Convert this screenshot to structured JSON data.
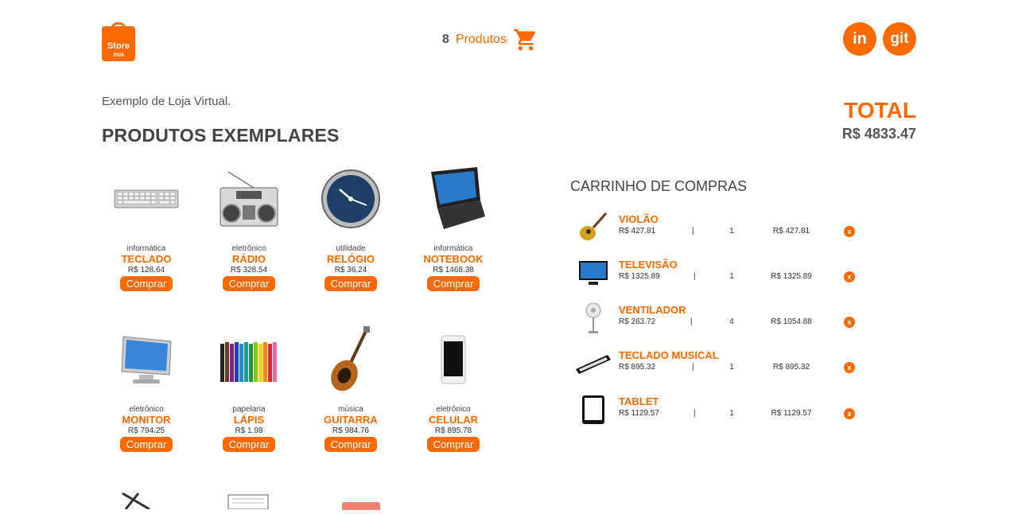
{
  "header": {
    "logo_text": "Store",
    "logo_year": "2024",
    "cart_count": "8",
    "cart_label": "Produtos",
    "social_linkedin": "in",
    "social_git": "git"
  },
  "intro": {
    "subtitle": "Exemplo de Loja Virtual.",
    "section_title": "PRODUTOS EXEMPLARES"
  },
  "total": {
    "label": "TOTAL",
    "value": "R$ 4833.47"
  },
  "products": [
    {
      "category": "informática",
      "name": "TECLADO",
      "price": "R$ 128.64",
      "button": "Comprar",
      "icon": "keyboard-icon"
    },
    {
      "category": "eletrônico",
      "name": "RÁDIO",
      "price": "R$ 328.54",
      "button": "Comprar",
      "icon": "radio-icon"
    },
    {
      "category": "utilidade",
      "name": "RELÓGIO",
      "price": "R$ 36.24",
      "button": "Comprar",
      "icon": "clock-icon"
    },
    {
      "category": "informática",
      "name": "NOTEBOOK",
      "price": "R$ 1468.38",
      "button": "Comprar",
      "icon": "laptop-icon"
    },
    {
      "category": "eletrônico",
      "name": "MONITOR",
      "price": "R$ 794.25",
      "button": "Comprar",
      "icon": "monitor-icon"
    },
    {
      "category": "papelaria",
      "name": "LÁPIS",
      "price": "R$ 1.98",
      "button": "Comprar",
      "icon": "pencils-icon"
    },
    {
      "category": "música",
      "name": "GUITARRA",
      "price": "R$ 984.76",
      "button": "Comprar",
      "icon": "guitar-icon"
    },
    {
      "category": "eletrônico",
      "name": "CELULAR",
      "price": "R$ 895.78",
      "button": "Comprar",
      "icon": "phone-icon"
    }
  ],
  "cart": {
    "title": "CARRINHO DE COMPRAS",
    "items": [
      {
        "name": "VIOLÃO",
        "price": "R$ 427.81",
        "sep": "|",
        "qty": "1",
        "subtotal": "R$ 427.81",
        "remove": "x",
        "icon": "acoustic-guitar-icon"
      },
      {
        "name": "TELEVISÃO",
        "price": "R$ 1325.89",
        "sep": "|",
        "qty": "1",
        "subtotal": "R$ 1325.89",
        "remove": "x",
        "icon": "tv-icon"
      },
      {
        "name": "VENTILADOR",
        "price": "R$ 263.72",
        "sep": "|",
        "qty": "4",
        "subtotal": "R$ 1054.88",
        "remove": "x",
        "icon": "fan-icon"
      },
      {
        "name": "TECLADO MUSICAL",
        "price": "R$ 895.32",
        "sep": "|",
        "qty": "1",
        "subtotal": "R$ 895.32",
        "remove": "x",
        "icon": "music-keyboard-icon"
      },
      {
        "name": "TABLET",
        "price": "R$ 1129.57",
        "sep": "|",
        "qty": "1",
        "subtotal": "R$ 1129.57",
        "remove": "x",
        "icon": "tablet-icon"
      }
    ]
  },
  "colors": {
    "accent": "#ff6a00",
    "text": "#444444"
  }
}
